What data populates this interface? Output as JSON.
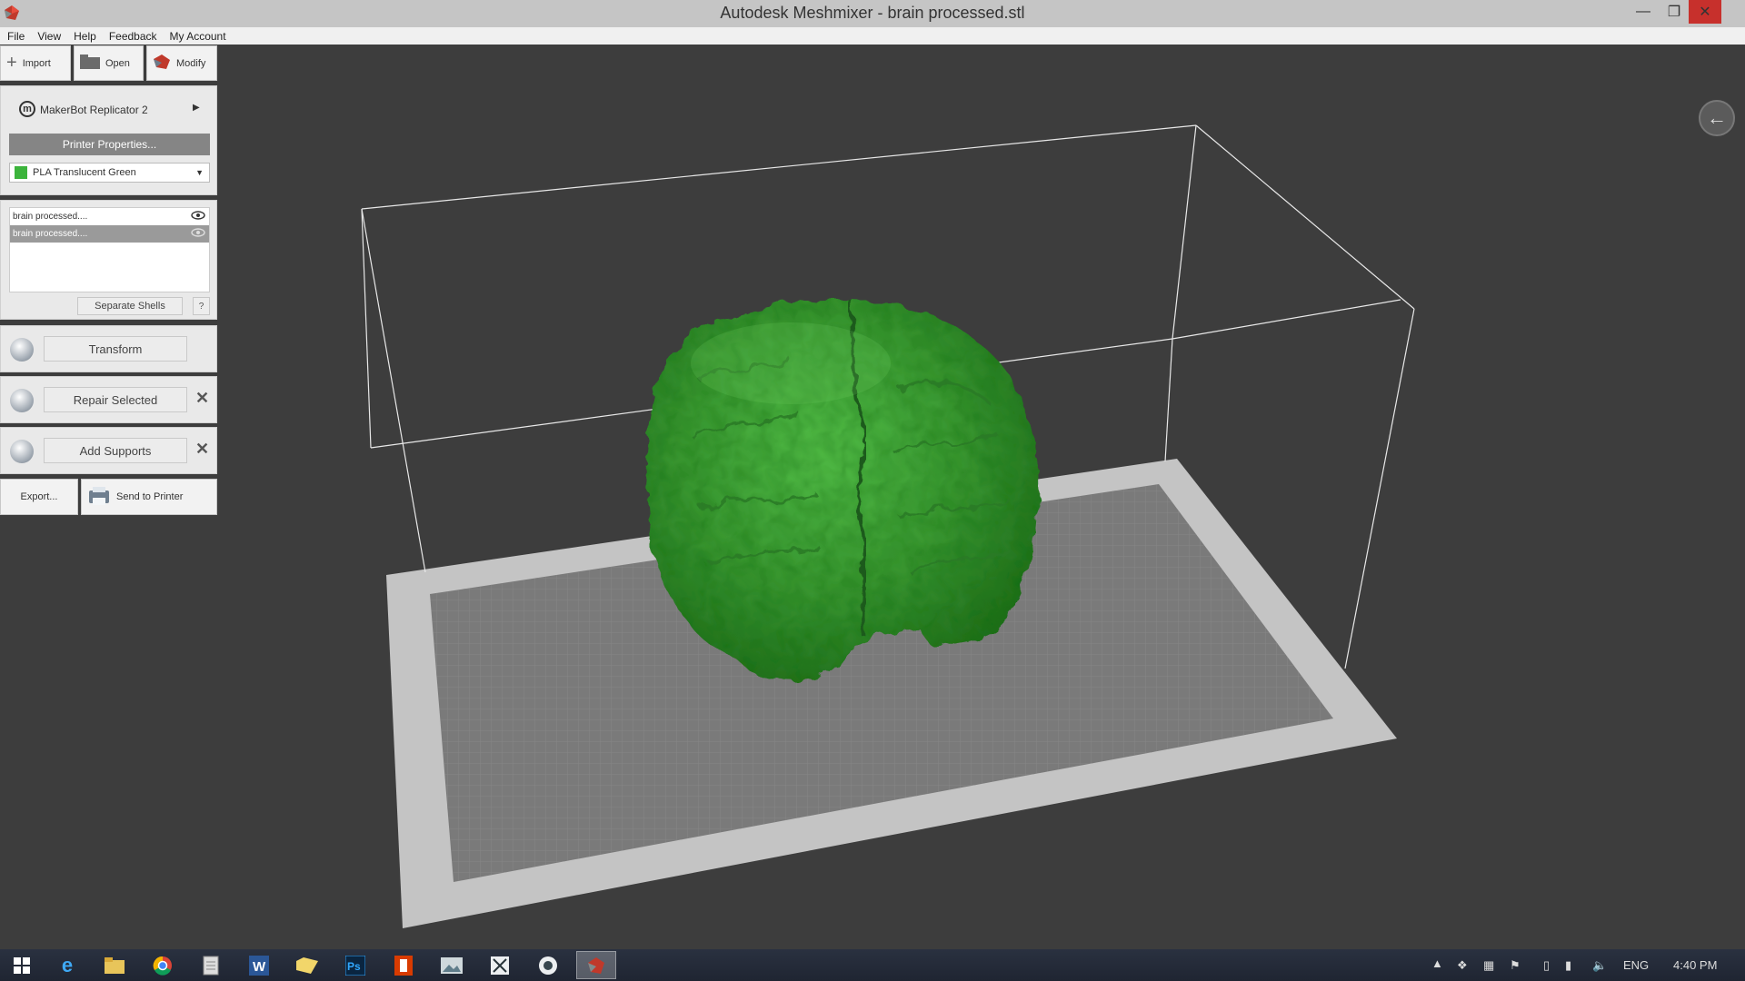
{
  "window": {
    "title": "Autodesk Meshmixer - brain processed.stl",
    "icon": "meshmixer-logo-icon",
    "minimize": "—",
    "maximize": "❐",
    "close": "✕"
  },
  "menu": [
    "File",
    "View",
    "Help",
    "Feedback",
    "My Account"
  ],
  "toolbar": {
    "import_label": "Import",
    "open_label": "Open",
    "modify_label": "Modify"
  },
  "printer": {
    "name": "MakerBot Replicator 2",
    "properties_label": "Printer Properties...",
    "material": "PLA Translucent Green",
    "material_color": "#3cb43c"
  },
  "objects": {
    "items": [
      "brain processed....",
      "brain processed...."
    ],
    "separate_shells_label": "Separate Shells",
    "help_label": "?"
  },
  "actions": {
    "transform_label": "Transform",
    "repair_label": "Repair Selected",
    "supports_label": "Add Supports",
    "export_label": "Export...",
    "send_label": "Send to Printer"
  },
  "taskbar": {
    "apps": [
      "windows-start-icon",
      "internet-explorer-icon",
      "file-explorer-icon",
      "chrome-icon",
      "notepad-icon",
      "word-icon",
      "folder-icon",
      "photoshop-icon",
      "office-icon",
      "photo-viewer-icon",
      "snipping-tool-icon",
      "media-icon",
      "meshmixer-icon"
    ],
    "language": "ENG",
    "time": "4:40 PM"
  },
  "colors": {
    "model_green": "#3d9b35",
    "viewport_bg": "#3d3d3d",
    "bed_frame": "#c8c8c8",
    "bed_grid": "#7a7a7a"
  }
}
